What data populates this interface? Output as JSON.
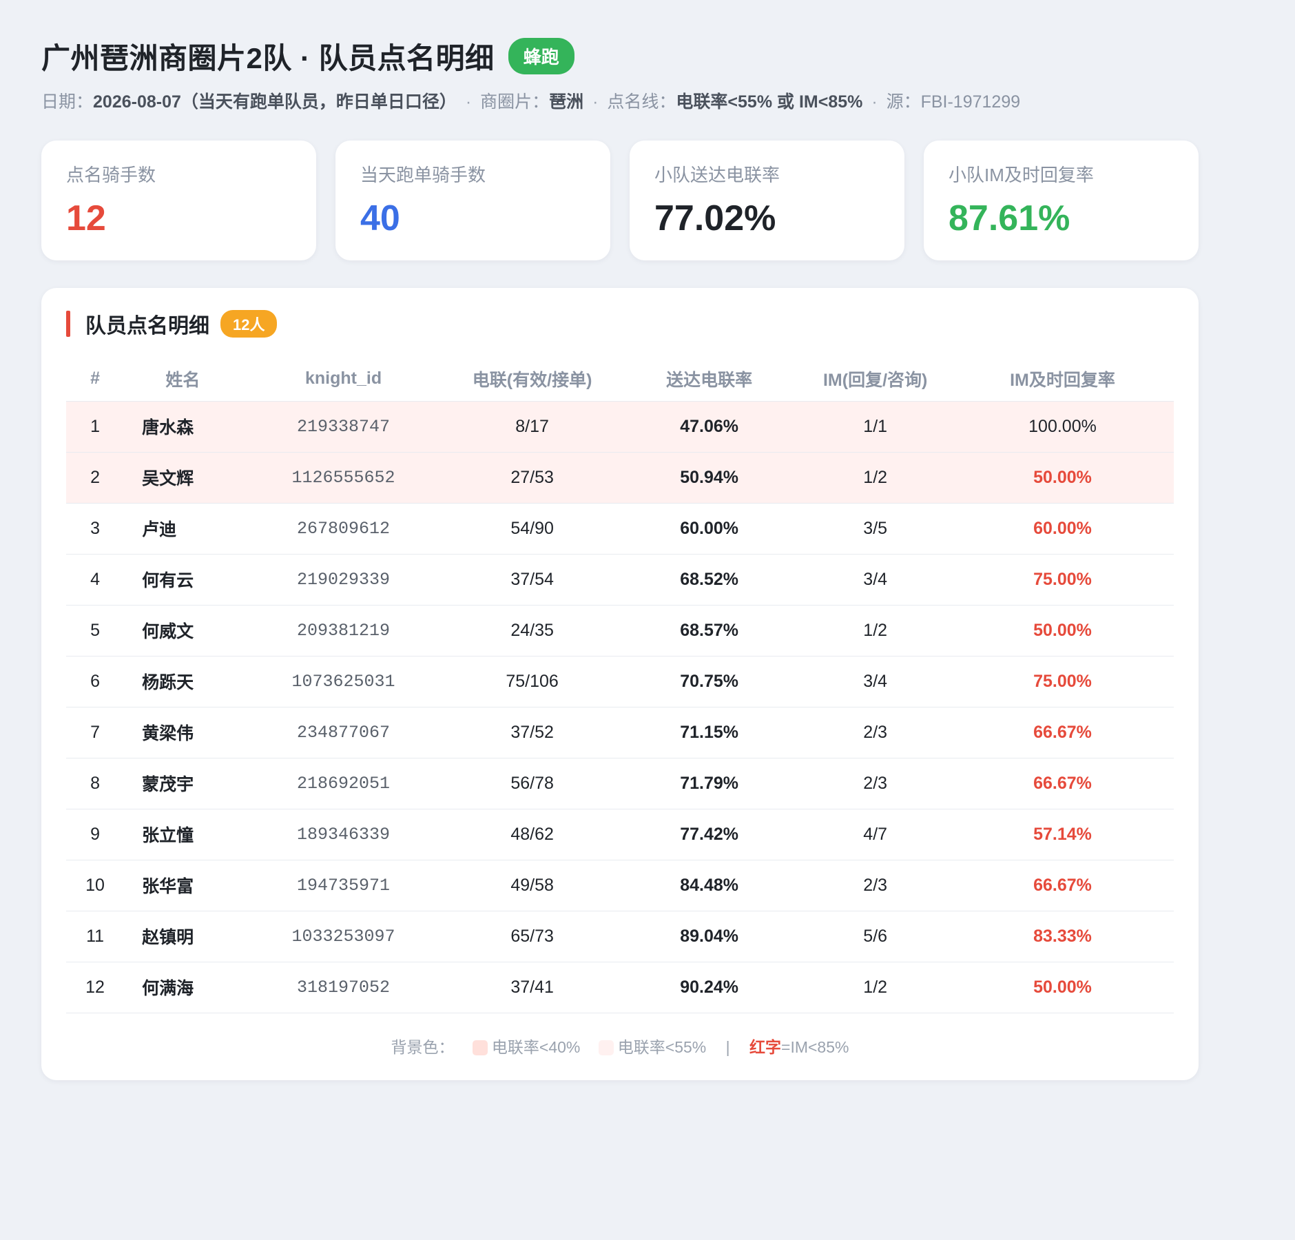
{
  "header": {
    "title": "广州琶洲商圈片2队 · 队员点名明细",
    "brand": "蜂跑",
    "date_label": "日期：",
    "date_value": "2026-08-07（当天有跑单队员，昨日单日口径）",
    "area_label": "商圈片：",
    "area_value": "琶洲",
    "rule_label": "点名线：",
    "rule_value": "电联率<55% 或 IM<85%",
    "source_label": "源：FBI-1971299",
    "separator": "·"
  },
  "cards": [
    {
      "label": "点名骑手数",
      "value": "12",
      "color": "#e64a3b"
    },
    {
      "label": "当天跑单骑手数",
      "value": "40",
      "color": "#3b6fe6"
    },
    {
      "label": "小队送达电联率",
      "value": "77.02%",
      "color": "#1f2329"
    },
    {
      "label": "小队IM及时回复率",
      "value": "87.61%",
      "color": "#34b45a"
    }
  ],
  "panel": {
    "title": "队员点名明细",
    "count": "12人",
    "columns": [
      "#",
      "姓名",
      "knight_id",
      "电联(有效/接单)",
      "送达电联率",
      "IM(回复/咨询)",
      "IM及时回复率"
    ],
    "rows": [
      {
        "no": "1",
        "name": "唐水森",
        "id": "219338747",
        "call": "8/17",
        "rate": "47.06%",
        "im": "1/1",
        "im_rate": "100.00%",
        "bg": "mid",
        "im_red": false
      },
      {
        "no": "2",
        "name": "吴文辉",
        "id": "1126555652",
        "call": "27/53",
        "rate": "50.94%",
        "im": "1/2",
        "im_rate": "50.00%",
        "bg": "mid",
        "im_red": true
      },
      {
        "no": "3",
        "name": "卢迪",
        "id": "267809612",
        "call": "54/90",
        "rate": "60.00%",
        "im": "3/5",
        "im_rate": "60.00%",
        "bg": "",
        "im_red": true
      },
      {
        "no": "4",
        "name": "何有云",
        "id": "219029339",
        "call": "37/54",
        "rate": "68.52%",
        "im": "3/4",
        "im_rate": "75.00%",
        "bg": "",
        "im_red": true
      },
      {
        "no": "5",
        "name": "何威文",
        "id": "209381219",
        "call": "24/35",
        "rate": "68.57%",
        "im": "1/2",
        "im_rate": "50.00%",
        "bg": "",
        "im_red": true
      },
      {
        "no": "6",
        "name": "杨跞天",
        "id": "1073625031",
        "call": "75/106",
        "rate": "70.75%",
        "im": "3/4",
        "im_rate": "75.00%",
        "bg": "",
        "im_red": true
      },
      {
        "no": "7",
        "name": "黄梁伟",
        "id": "234877067",
        "call": "37/52",
        "rate": "71.15%",
        "im": "2/3",
        "im_rate": "66.67%",
        "bg": "",
        "im_red": true
      },
      {
        "no": "8",
        "name": "蒙茂宇",
        "id": "218692051",
        "call": "56/78",
        "rate": "71.79%",
        "im": "2/3",
        "im_rate": "66.67%",
        "bg": "",
        "im_red": true
      },
      {
        "no": "9",
        "name": "张立憧",
        "id": "189346339",
        "call": "48/62",
        "rate": "77.42%",
        "im": "4/7",
        "im_rate": "57.14%",
        "bg": "",
        "im_red": true
      },
      {
        "no": "10",
        "name": "张华富",
        "id": "194735971",
        "call": "49/58",
        "rate": "84.48%",
        "im": "2/3",
        "im_rate": "66.67%",
        "bg": "",
        "im_red": true
      },
      {
        "no": "11",
        "name": "赵镇明",
        "id": "1033253097",
        "call": "65/73",
        "rate": "89.04%",
        "im": "5/6",
        "im_rate": "83.33%",
        "bg": "",
        "im_red": true
      },
      {
        "no": "12",
        "name": "何满海",
        "id": "318197052",
        "call": "37/41",
        "rate": "90.24%",
        "im": "1/2",
        "im_rate": "50.00%",
        "bg": "",
        "im_red": true
      }
    ]
  },
  "legend": {
    "prefix": "背景色：",
    "low_label": "电联率<40%",
    "low_color": "#ffe0db",
    "mid_label": "电联率<55%",
    "mid_color": "#fff1f0",
    "pipe": "|",
    "red_text": "红字",
    "red_rule": "=IM<85%"
  }
}
